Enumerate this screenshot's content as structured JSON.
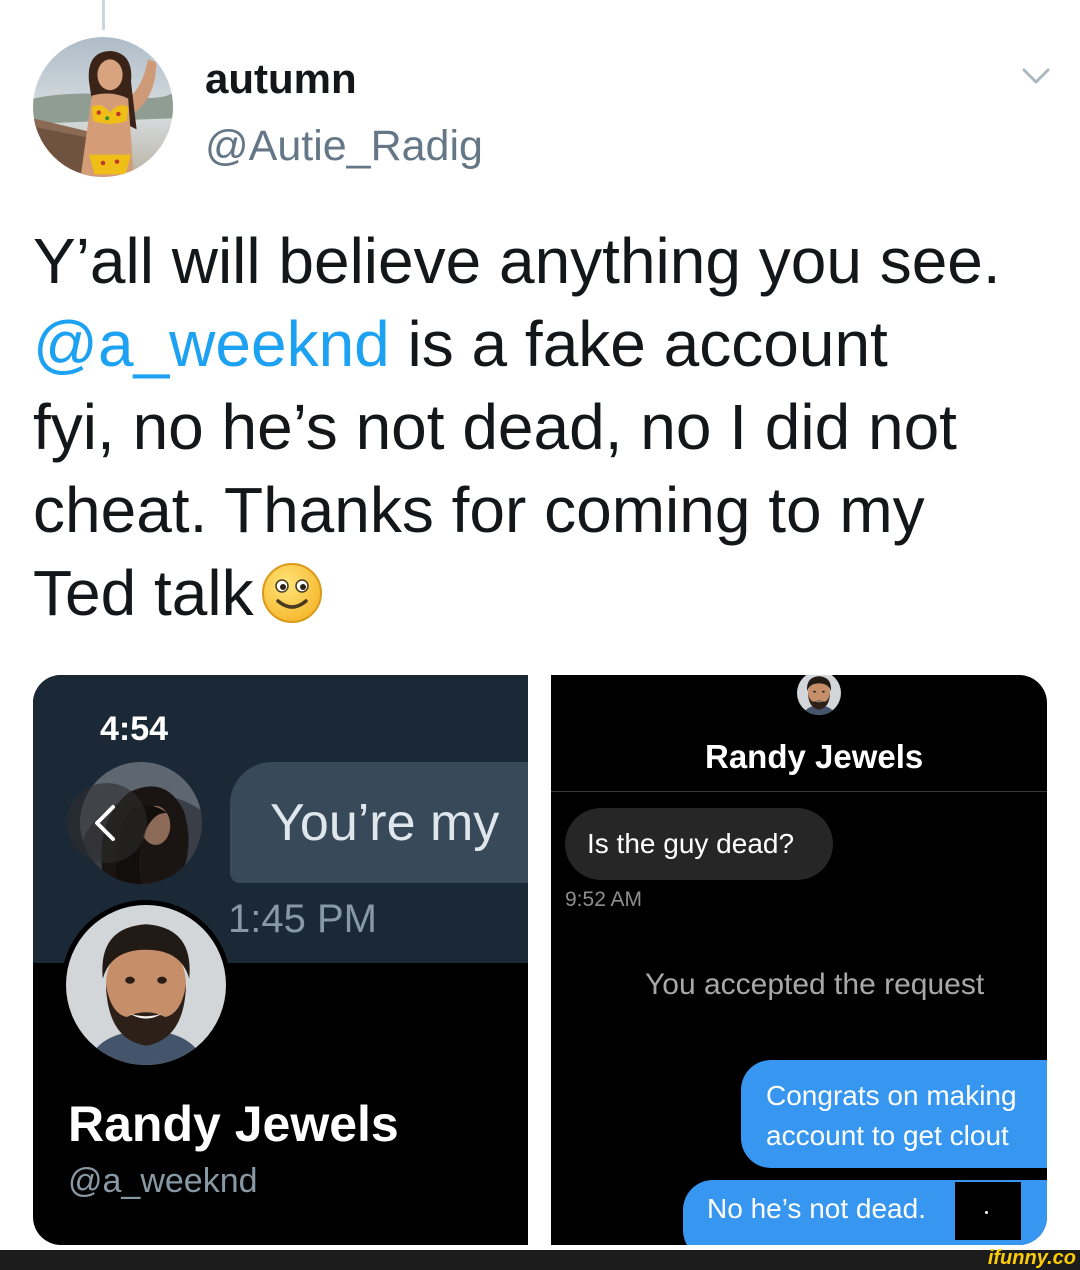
{
  "author": {
    "avatar": "author-avatar",
    "name": "autumn",
    "handle": "@Autie_Radig"
  },
  "menu": {
    "icon": "chevron-down-icon"
  },
  "tweet": {
    "line1": "Y’all will believe anything you see.",
    "mention": "@a_weeknd",
    "line2_rest": " is a fake account",
    "line3": "fyi, no he’s not dead, no I did not",
    "line4": "cheat. Thanks for coming to my",
    "line5": "Ted talk",
    "emoji_icon": "slightly-smiling-face-icon"
  },
  "media": {
    "left": {
      "status_time": "4:54",
      "back_icon": "chevron-left-icon",
      "message": "You’re my",
      "message_time": "1:45 PM",
      "profile_name": "Randy Jewels",
      "profile_handle": "@a_weeknd"
    },
    "right": {
      "contact_name": "Randy Jewels",
      "received_message": "Is the guy dead?",
      "received_time": "9:52 AM",
      "system_notice": "You accepted the request",
      "sent_messages": [
        "Congrats on making account to get clout",
        "No he’s not dead."
      ]
    }
  },
  "colors": {
    "text": "#14171a",
    "secondary_text": "#657786",
    "mention": "#1da1f2",
    "dm_sent_bubble": "#3797f0",
    "watermark": "#fccc0a"
  },
  "watermark": "ifunny.co"
}
